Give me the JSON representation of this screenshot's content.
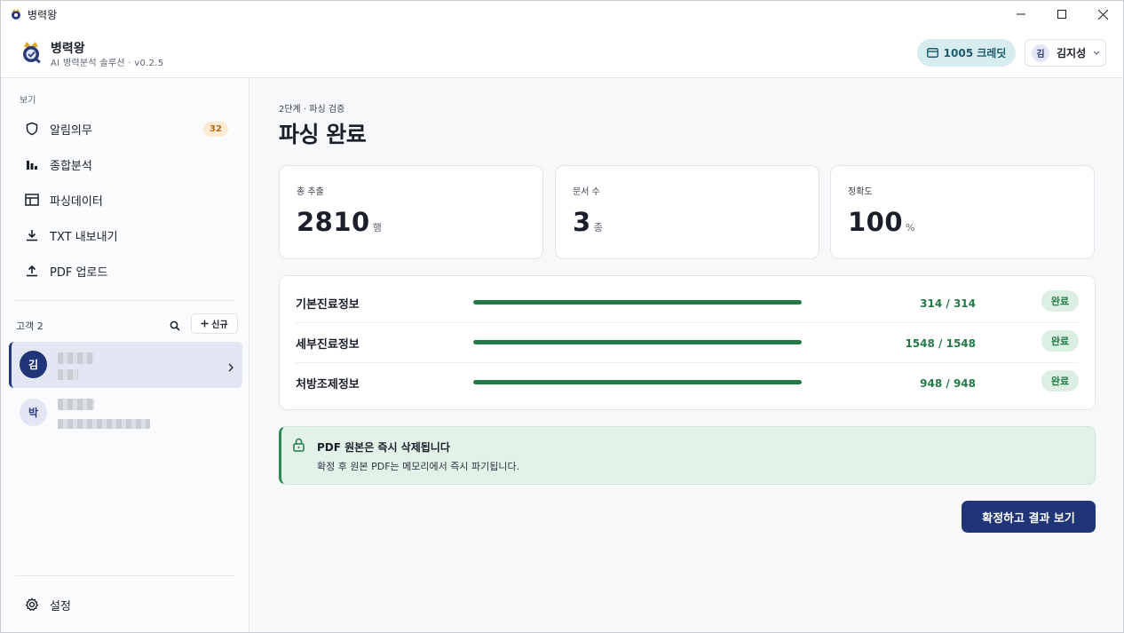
{
  "window": {
    "title": "병력왕"
  },
  "header": {
    "brand_name": "병력왕",
    "brand_sub": "AI 병력분석 솔루션 · v0.2.5",
    "credits": "1005 크레딧",
    "user_initial": "김",
    "user_name": "김지성"
  },
  "sidebar": {
    "section_label": "보기",
    "nav": [
      {
        "label": "알림의무",
        "icon": "shield-icon",
        "badge": "32"
      },
      {
        "label": "종합분석",
        "icon": "bar-chart-icon"
      },
      {
        "label": "파싱데이터",
        "icon": "table-icon"
      },
      {
        "label": "TXT 내보내기",
        "icon": "download-icon"
      },
      {
        "label": "PDF 업로드",
        "icon": "upload-icon"
      }
    ],
    "customers_label": "고객 2",
    "new_button": "신규",
    "customers": [
      {
        "initial": "김",
        "active": true
      },
      {
        "initial": "박",
        "active": false
      }
    ],
    "settings_label": "설정"
  },
  "main": {
    "step_label": "2단계 · 파싱 검증",
    "title": "파싱 완료",
    "stats": [
      {
        "label": "총 추출",
        "value": "2810",
        "unit": "행"
      },
      {
        "label": "문서 수",
        "value": "3",
        "unit": "종"
      },
      {
        "label": "정확도",
        "value": "100",
        "unit": "%"
      }
    ],
    "progress": [
      {
        "name": "기본진료정보",
        "count": "314 / 314",
        "fraction": 1.0,
        "status": "완료"
      },
      {
        "name": "세부진료정보",
        "count": "1548 / 1548",
        "fraction": 1.0,
        "status": "완료"
      },
      {
        "name": "처방조제정보",
        "count": "948 / 948",
        "fraction": 1.0,
        "status": "완료"
      }
    ],
    "notice": {
      "title": "PDF 원본은 즉시 삭제됩니다",
      "text": "확정 후 원본 PDF는 메모리에서 즉시 파기됩니다."
    },
    "confirm_button": "확정하고 결과 보기"
  },
  "colors": {
    "brand": "#1f3577",
    "success": "#237a46",
    "badge_orange": "#b5681a"
  }
}
